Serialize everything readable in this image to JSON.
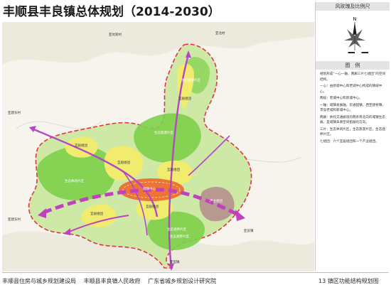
{
  "title": "丰顺县丰良镇总体规划（2014-2030）",
  "sidebar": {
    "compass_title": "风玫瑰及比例尺",
    "north_label": "N",
    "legend_title": "图　例",
    "legend_paragraphs": [
      "规划形成“一心一轴、两廊三片七组团”的空间结构。",
      "一心：由新城中心和老城中心构成的镇域中心。",
      "两核：老城中心和新城中心。",
      "一轴：城镇发展轴，东通韶镇，西至建桥镇，贯穿老城和新城中心。",
      "两廊：依托交通廊道的两条南北向的城镇生态廊，是城镇未来空间拓展的方向。",
      "三片：生态休闲片区，生态旅游片区，生态涵养片区。",
      "七组团：六个宜居组团和一个产业组团。"
    ]
  },
  "map": {
    "place_labels": [
      {
        "id": "xinheng",
        "text": "亚坑新村"
      },
      {
        "id": "ne",
        "text": "亚北村"
      },
      {
        "id": "west-upper",
        "text": "亚建东村"
      },
      {
        "id": "west-lower",
        "text": "亚建东村"
      },
      {
        "id": "south",
        "text": "亚田镇"
      },
      {
        "id": "east",
        "text": "亚良镇"
      }
    ],
    "zone_labels": [
      {
        "id": "leisure-west",
        "text": "生态休闲片区"
      },
      {
        "id": "tourism",
        "text": "生态旅游片区"
      },
      {
        "id": "tourism-north",
        "text": "生态旅游片区"
      },
      {
        "id": "conservation",
        "text": "生态涵养片区"
      },
      {
        "id": "conservation-south",
        "text": "生态涵养片区"
      },
      {
        "id": "industry",
        "text": "产业组团"
      },
      {
        "id": "center",
        "text": "城镇中心"
      }
    ],
    "cluster_labels": [
      {
        "id": "c1",
        "text": "宜居组团"
      },
      {
        "id": "c2",
        "text": "宜居组团"
      },
      {
        "id": "c3",
        "text": "宜居组团"
      },
      {
        "id": "c4",
        "text": "宜居组团"
      },
      {
        "id": "c5",
        "text": "宜居组团"
      },
      {
        "id": "c6",
        "text": "宜居组团"
      }
    ],
    "colors": {
      "boundary": "#e0344a",
      "ecology": "#7ed04b",
      "livable": "#f2ec6e",
      "center": "#ef6a2c",
      "industry": "#b38b8b",
      "corridor": "#b347c4",
      "axis": "#c040c0"
    }
  },
  "footer": {
    "orgs": [
      "丰顺县住房与城乡规划建设局",
      "丰顺县丰良镇人民政府",
      "广东省城乡规划设计研究院"
    ],
    "sheet": "13 镇区功能结构规划图"
  }
}
